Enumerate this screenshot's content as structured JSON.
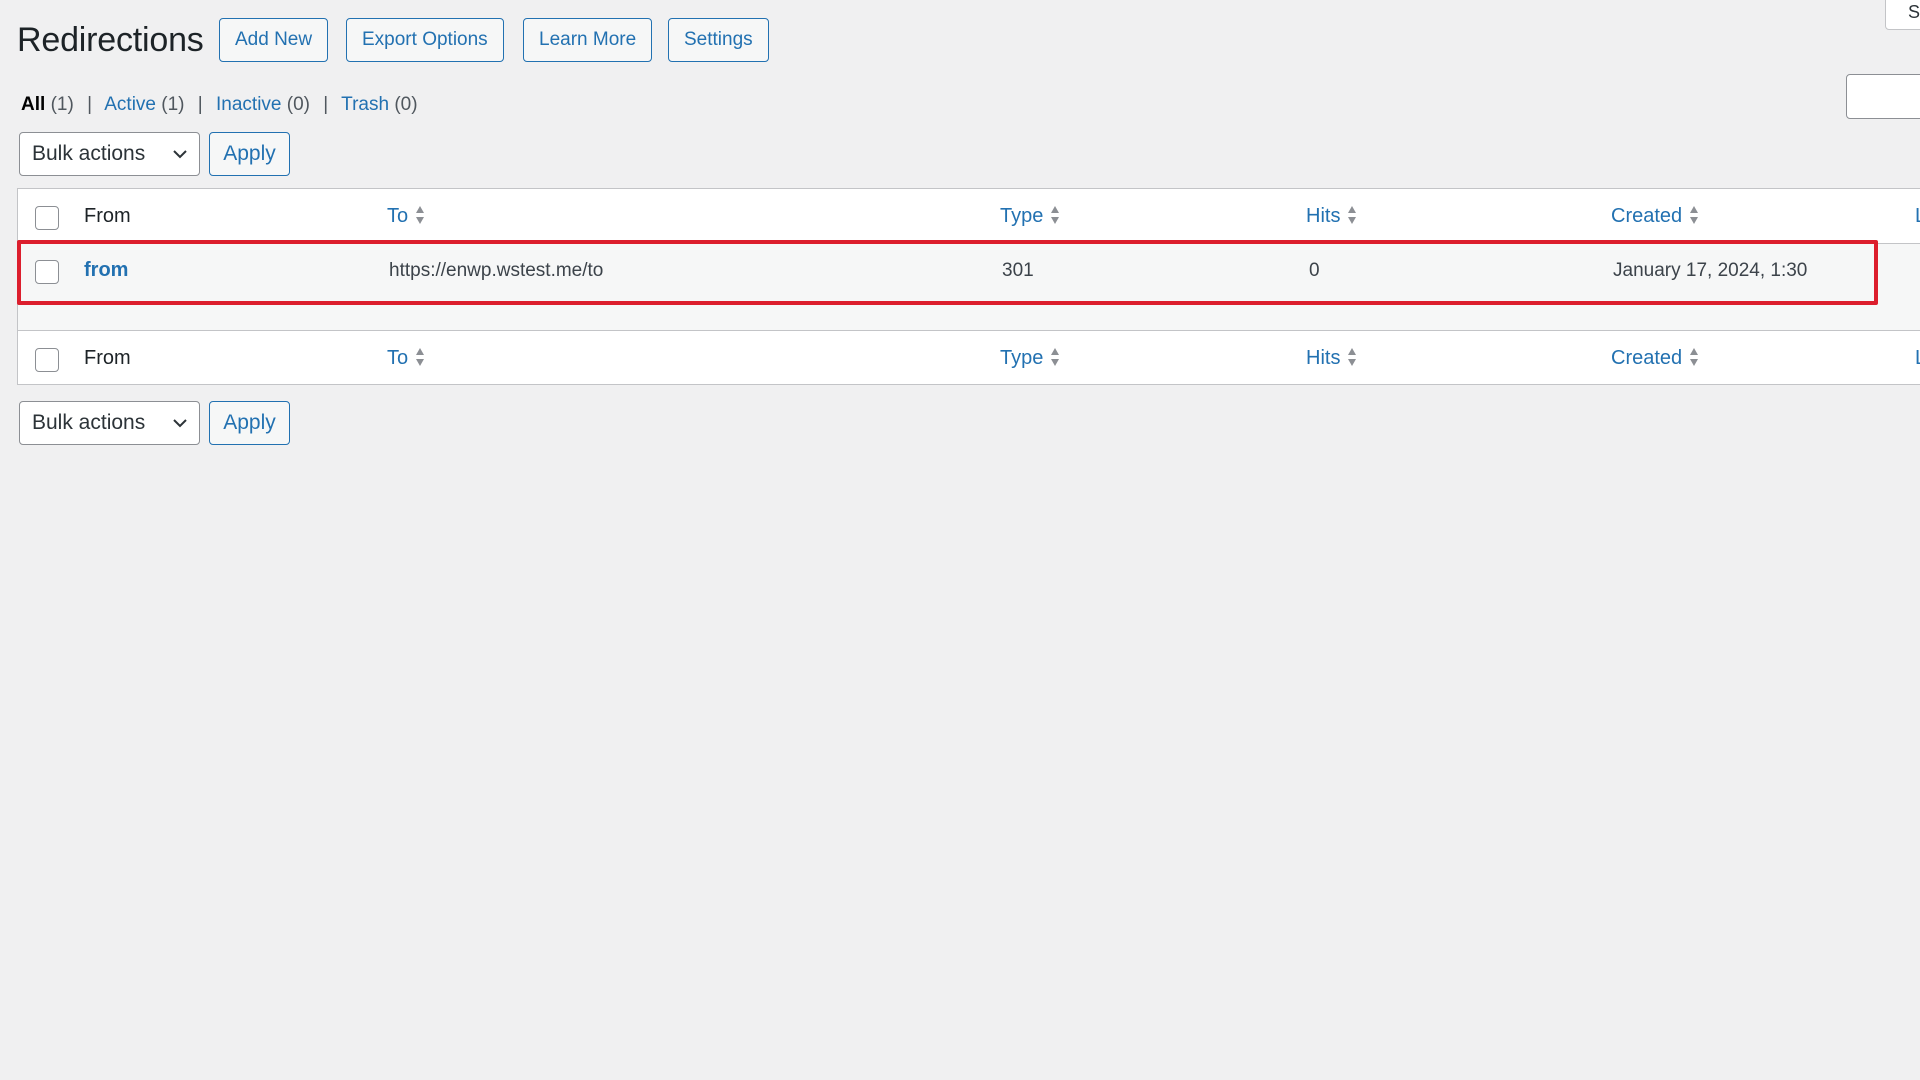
{
  "page": {
    "title": "Redirections",
    "header_buttons": [
      "Add New",
      "Export Options",
      "Learn More",
      "Settings"
    ],
    "top_right_partial": "S"
  },
  "filters": [
    {
      "label": "All",
      "count": "(1)"
    },
    {
      "label": "Active",
      "count": "(1)"
    },
    {
      "label": "Inactive",
      "count": "(0)"
    },
    {
      "label": "Trash",
      "count": "(0)"
    }
  ],
  "bulk": {
    "select_value": "Bulk actions",
    "apply_label": "Apply"
  },
  "table": {
    "columns": [
      "From",
      "To",
      "Type",
      "Hits",
      "Created",
      "L"
    ],
    "rows": [
      {
        "from": "from",
        "to": "https://enwp.wstest.me/to",
        "type": "301",
        "hits": "0",
        "created": "January 17, 2024, 1:30"
      }
    ]
  },
  "colors": {
    "accent": "#2271b1",
    "highlight": "#dc1e2d",
    "background": "#f0f0f1"
  }
}
